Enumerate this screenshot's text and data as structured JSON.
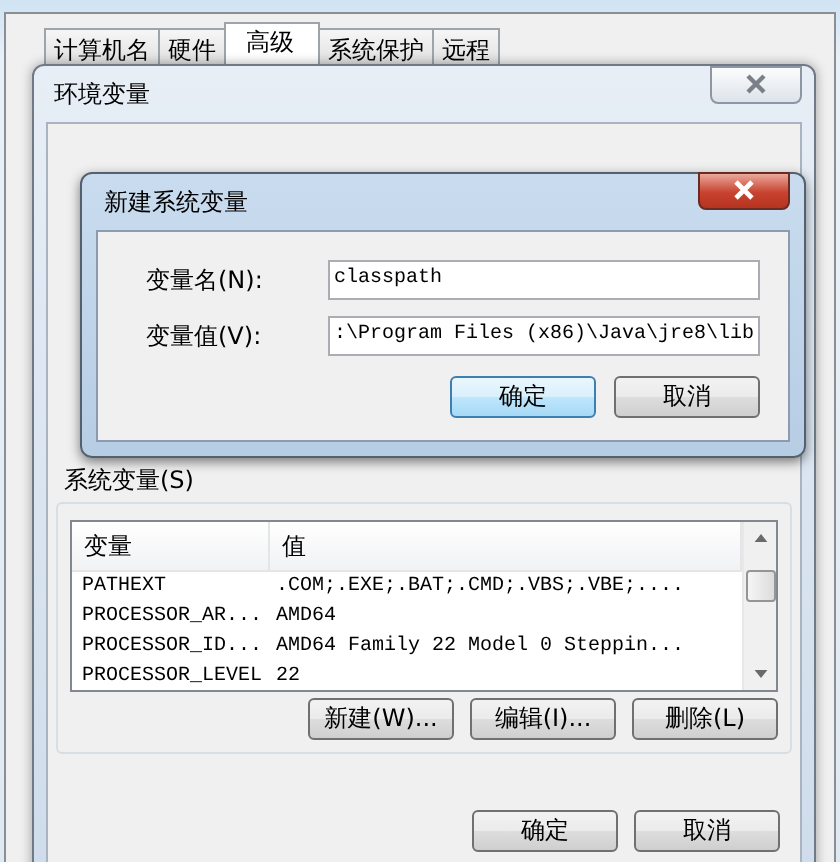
{
  "system_properties": {
    "tabs": [
      {
        "label": "计算机名",
        "selected": false
      },
      {
        "label": "硬件",
        "selected": false
      },
      {
        "label": "高级",
        "selected": true
      },
      {
        "label": "系统保护",
        "selected": false
      },
      {
        "label": "远程",
        "selected": false
      }
    ]
  },
  "environment_window": {
    "title": "环境变量",
    "system_variables": {
      "label": "系统变量(S)",
      "columns": [
        "变量",
        "值"
      ],
      "rows": [
        {
          "name": "PATHEXT",
          "value": ".COM;.EXE;.BAT;.CMD;.VBS;.VBE;...."
        },
        {
          "name": "PROCESSOR_AR...",
          "value": "AMD64"
        },
        {
          "name": "PROCESSOR_ID...",
          "value": "AMD64 Family 22 Model 0 Steppin..."
        },
        {
          "name": "PROCESSOR_LEVEL",
          "value": "22"
        }
      ],
      "buttons": [
        "新建(W)...",
        "编辑(I)...",
        "删除(L)"
      ]
    },
    "buttons": [
      "确定",
      "取消"
    ]
  },
  "new_variable_dialog": {
    "title": "新建系统变量",
    "fields": [
      {
        "label": "变量名(N):",
        "value": "classpath"
      },
      {
        "label": "变量值(V):",
        "value": ":\\Program Files (x86)\\Java\\jre8\\lib"
      }
    ],
    "buttons": [
      {
        "label": "确定",
        "default": true
      },
      {
        "label": "取消",
        "default": false
      }
    ]
  }
}
